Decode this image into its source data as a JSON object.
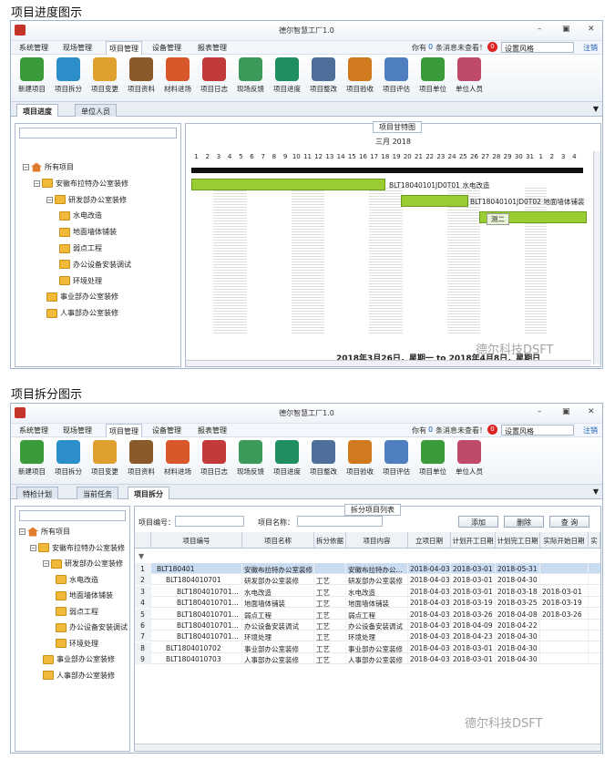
{
  "captions": {
    "top": "项目进度图示",
    "bottom": "项目拆分图示"
  },
  "app": {
    "title": "德尔智慧工厂1.0",
    "menus": [
      "系统管理",
      "现场管理",
      "项目管理",
      "设备管理",
      "报表管理"
    ],
    "msg_pre": "你有",
    "msg_count": "0",
    "msg_post": "条消息未查看！",
    "msg_badge": "0",
    "style_label": "设置风格",
    "logout": "注销"
  },
  "toolbar": [
    "新建项目",
    "项目拆分",
    "项目变更",
    "项目资料",
    "材料进场",
    "项目日志",
    "现场反馈",
    "项目进度",
    "项目整改",
    "项目验收",
    "项目评估",
    "项目单位",
    "单位人员"
  ],
  "s1": {
    "tabs": [
      "项目进度",
      "单位人员"
    ],
    "tree": [
      "所有项目",
      "安徽布拉特办公室装修",
      "研发部办公室装修",
      "水电改造",
      "地面墙体铺装",
      "弱点工程",
      "办公设备安装调试",
      "环境处理",
      "事业部办公室装修",
      "人事部办公室装修"
    ],
    "gantt_title": "项目甘特图",
    "month": "三月 2018",
    "days": [
      "1",
      "2",
      "3",
      "4",
      "5",
      "6",
      "7",
      "8",
      "9",
      "10",
      "11",
      "12",
      "13",
      "14",
      "15",
      "16",
      "17",
      "18",
      "19",
      "20",
      "21",
      "22",
      "23",
      "24",
      "25",
      "26",
      "27",
      "28",
      "29",
      "30",
      "31",
      "1",
      "2",
      "3",
      "4"
    ],
    "bar_labels": [
      "BLT18040101JD0T01 水电改造",
      "BLT18040101JD0T02 地面墙体铺装",
      "测二"
    ],
    "date_range": "2018年3月26日，星期一 to 2018年4月8日，星期日"
  },
  "s2": {
    "tabs": [
      "特检计划",
      "当前任务",
      "项目拆分"
    ],
    "tree": [
      "所有项目",
      "安徽布拉特办公室装修",
      "研发部办公室装修",
      "水电改造",
      "地面墙体铺装",
      "弱点工程",
      "办公设备安装调试",
      "环境处理",
      "事业部办公室装修",
      "人事部办公室装修"
    ],
    "panel_title": "拆分项目列表",
    "code_label": "项目编号：",
    "name_label": "项目名称：",
    "buttons": [
      "添加",
      "删除",
      "查 询"
    ],
    "columns": [
      "项目编号",
      "项目名称",
      "拆分依据",
      "项目内容",
      "立项日期",
      "计划开工日期",
      "计划完工日期",
      "实际开始日期",
      "实"
    ],
    "rows": [
      [
        "1",
        "BLT180401",
        "安徽布拉特办公室装修",
        "",
        "安徽布拉特办公...",
        "2018-04-03",
        "2018-03-01",
        "2018-05-31",
        ""
      ],
      [
        "2",
        "BLT1804010701",
        "研发部办公室装修",
        "工艺",
        "研发部办公室装修",
        "2018-04-03",
        "2018-03-01",
        "2018-04-30",
        ""
      ],
      [
        "3",
        "BLT1804010701...",
        "水电改造",
        "工艺",
        "水电改造",
        "2018-04-03",
        "2018-03-01",
        "2018-03-18",
        "2018-03-01"
      ],
      [
        "4",
        "BLT1804010701...",
        "地面墙体铺装",
        "工艺",
        "地面墙体铺装",
        "2018-04-03",
        "2018-03-19",
        "2018-03-25",
        "2018-03-19"
      ],
      [
        "5",
        "BLT1804010701...",
        "弱点工程",
        "工艺",
        "弱点工程",
        "2018-04-03",
        "2018-03-26",
        "2018-04-08",
        "2018-03-26"
      ],
      [
        "6",
        "BLT1804010701...",
        "办公设备安装调试",
        "工艺",
        "办公设备安装调试",
        "2018-04-03",
        "2018-04-09",
        "2018-04-22",
        ""
      ],
      [
        "7",
        "BLT1804010701...",
        "环境处理",
        "工艺",
        "环境处理",
        "2018-04-03",
        "2018-04-23",
        "2018-04-30",
        ""
      ],
      [
        "8",
        "BLT1804010702",
        "事业部办公室装修",
        "工艺",
        "事业部办公室装修",
        "2018-04-03",
        "2018-03-01",
        "2018-04-30",
        ""
      ],
      [
        "9",
        "BLT1804010703",
        "人事部办公室装修",
        "工艺",
        "人事部办公室装修",
        "2018-04-03",
        "2018-03-01",
        "2018-04-30",
        ""
      ]
    ]
  },
  "watermark": "德尔科技DSFT",
  "colors": {
    "accent": "#9acd32",
    "titlebar": "#eef3f9",
    "logo": "#c4342a"
  }
}
